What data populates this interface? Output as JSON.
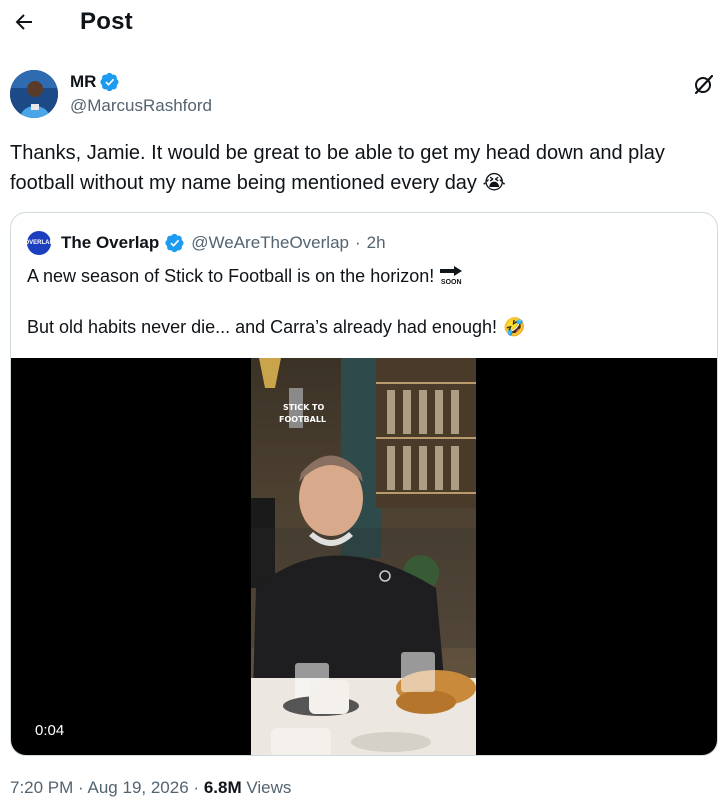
{
  "header": {
    "title": "Post",
    "back_icon": "arrow-left-icon"
  },
  "author": {
    "name": "MR",
    "handle": "@MarcusRashford",
    "verified_icon": "verified-badge-icon",
    "verified_color": "#1d9bf0",
    "grok_icon": "grok-icon"
  },
  "post": {
    "text": "Thanks, Jamie. It would be great to be able to get my head down and play football without my name being mentioned every day",
    "emoji": "😭"
  },
  "quote": {
    "avatar_text": "OVERLAP",
    "name": "The Overlap",
    "handle": "@WeAreTheOverlap",
    "separator": "·",
    "time": "2h",
    "line1": "A new season of Stick to Football is on the horizon!",
    "line1_emoji_text": "SOON",
    "line2": "But old habits never die... and Carra’s already had enough!",
    "line2_emoji": "🤣",
    "video": {
      "duration": "0:04",
      "logo_text_1": "STICK TO",
      "logo_text_2": "FOOTBALL"
    }
  },
  "meta": {
    "time": "7:20 PM",
    "dot": "·",
    "date": "Aug 19, 2026",
    "views_count": "6.8M",
    "views_label": "Views"
  }
}
